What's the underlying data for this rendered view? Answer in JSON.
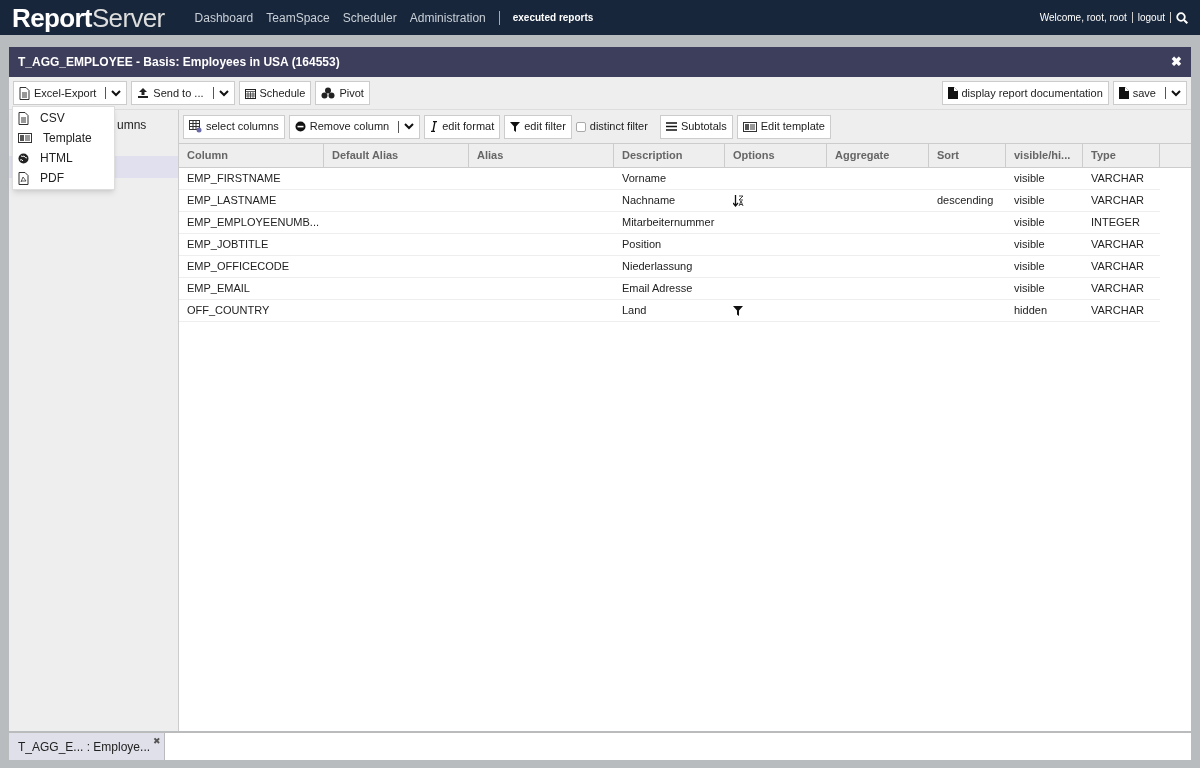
{
  "navbar": {
    "logo_bold": "Report",
    "logo_light": "Server",
    "links": [
      "Dashboard",
      "TeamSpace",
      "Scheduler",
      "Administration"
    ],
    "current": "executed reports",
    "welcome": "Welcome, root, root",
    "logout": "logout"
  },
  "window": {
    "title": "T_AGG_EMPLOYEE - Basis: Employees in USA (164553)",
    "close": "✖"
  },
  "toolbar": {
    "left": [
      {
        "label": "Excel-Export",
        "kind": "dropdown"
      },
      {
        "label": "Send to ...",
        "kind": "dropdown"
      },
      {
        "label": "Schedule",
        "kind": "button"
      },
      {
        "label": "Pivot",
        "kind": "button"
      }
    ],
    "right": [
      {
        "label": "display report documentation",
        "kind": "button"
      },
      {
        "label": "save",
        "kind": "dropdown"
      }
    ]
  },
  "export_menu": [
    {
      "label": "CSV"
    },
    {
      "label": "Template"
    },
    {
      "label": "HTML"
    },
    {
      "label": "PDF"
    }
  ],
  "sidebar": {
    "items": [
      {
        "label": "umns",
        "selected": false
      },
      {
        "selected": true
      }
    ]
  },
  "column_toolbar": [
    {
      "label": "select columns",
      "kind": "button"
    },
    {
      "label": "Remove column",
      "kind": "dropdown"
    },
    {
      "label": "edit format",
      "kind": "button"
    },
    {
      "label": "edit filter",
      "kind": "button"
    },
    {
      "label": "distinct filter",
      "kind": "checkbox",
      "checked": false
    },
    {
      "label": "Subtotals",
      "kind": "button"
    },
    {
      "label": "Edit template",
      "kind": "button"
    }
  ],
  "table": {
    "columns": [
      "Column",
      "Default Alias",
      "Alias",
      "Description",
      "Options",
      "Aggregate",
      "Sort",
      "visible/hi...",
      "Type"
    ],
    "rows": [
      {
        "kind": "plain",
        "column": "EMP_FIRSTNAME",
        "description": "Vorname",
        "visibility": "visible",
        "type": "VARCHAR"
      },
      {
        "kind": "sorted",
        "column": "EMP_LASTNAME",
        "description": "Nachname",
        "sort": "descending",
        "visibility": "visible",
        "type": "VARCHAR"
      },
      {
        "kind": "plain",
        "column": "EMP_EMPLOYEENUMB...",
        "description": "Mitarbeiternummer",
        "visibility": "visible",
        "type": "INTEGER"
      },
      {
        "kind": "plain",
        "column": "EMP_JOBTITLE",
        "description": "Position",
        "visibility": "visible",
        "type": "VARCHAR"
      },
      {
        "kind": "plain",
        "column": "EMP_OFFICECODE",
        "description": "Niederlassung",
        "visibility": "visible",
        "type": "VARCHAR"
      },
      {
        "kind": "plain",
        "column": "EMP_EMAIL",
        "description": "Email Adresse",
        "visibility": "visible",
        "type": "VARCHAR"
      },
      {
        "kind": "filtered",
        "column": "OFF_COUNTRY",
        "description": "Land",
        "visibility": "hidden",
        "type": "VARCHAR"
      }
    ]
  },
  "bottom_tabs": [
    {
      "label": "T_AGG_E... : Employe...",
      "close": "✖",
      "selected": true
    }
  ]
}
